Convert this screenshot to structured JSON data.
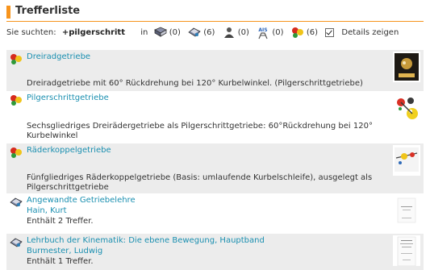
{
  "header": {
    "title": "Trefferliste"
  },
  "search": {
    "label": "Sie suchten:",
    "term": "+pilgerschritt",
    "in_label": "in",
    "counts": [
      "(0)",
      "(6)",
      "(0)",
      "(0)",
      "(6)"
    ],
    "count_icons": [
      "book-icon",
      "catalog-icon",
      "person-icon",
      "ais-icon",
      "model-icon"
    ],
    "details_label": "Details zeigen",
    "details_checked": true
  },
  "results": [
    {
      "type": "model",
      "title": "Dreiradgetriebe",
      "description": "Dreiradgetriebe mit 60° Rückdrehung bei 120° Kurbelwinkel. (Pilgerschrittgetriebe)"
    },
    {
      "type": "model",
      "title": "Pilgerschrittgetriebe",
      "description": "Sechsgliedriges Dreirädergetriebe als Pilgerschrittgetriebe: 60°Rückdrehung bei 120° Kurbelwinkel"
    },
    {
      "type": "model",
      "title": "Räderkoppelgetriebe",
      "description": "Fünfgliedriges Räderkoppelgetriebe (Basis: umlaufende Kurbelschleife), ausgelegt als Pilgerschrittgetriebe"
    },
    {
      "type": "book",
      "title": "Angewandte Getriebelehre",
      "author": "Hain, Kurt",
      "hits": "Enthält 2 Treffer."
    },
    {
      "type": "book",
      "title": "Lehrbuch der Kinematik: Die ebene Bewegung, Hauptband",
      "author": "Burmester, Ludwig",
      "hits": "Enthält 1 Treffer."
    }
  ]
}
